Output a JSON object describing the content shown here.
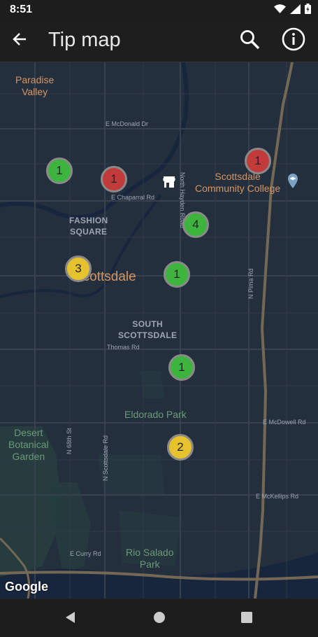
{
  "status_bar": {
    "time": "8:51"
  },
  "app_bar": {
    "title": "Tip map"
  },
  "map": {
    "area_labels": [
      {
        "text": "Paradise\nValley"
      },
      {
        "text": "Scottsdale\nCommunity College"
      },
      {
        "text": "Desert\nBotanical\nGarden"
      },
      {
        "text": "Eldorado Park"
      },
      {
        "text": "Rio Salado\nPark"
      }
    ],
    "city_label": "Scottsdale",
    "district_labels": [
      "FASHION\nSQUARE",
      "SOUTH\nSCOTTSDALE"
    ],
    "road_labels": [
      "E McDonald Dr",
      "E Chaparral Rd",
      "Thomas Rd",
      "E McDowell Rd",
      "E McKellips Rd",
      "E Curry Rd"
    ],
    "vertical_road_labels": [
      "North Hayden Road",
      "N Pima Rd",
      "N 68th St",
      "N Scottsdale Rd"
    ],
    "markers": [
      {
        "count": "1",
        "color": "#3db43d"
      },
      {
        "count": "1",
        "color": "#c23b3b"
      },
      {
        "count": "1",
        "color": "#c23b3b"
      },
      {
        "count": "4",
        "color": "#3db43d"
      },
      {
        "count": "3",
        "color": "#e6c22e"
      },
      {
        "count": "1",
        "color": "#3db43d"
      },
      {
        "count": "1",
        "color": "#3db43d"
      },
      {
        "count": "2",
        "color": "#e6c22e"
      }
    ],
    "attribution": "Google",
    "icons": {
      "store": "store-icon",
      "school_pin": "school-pin-icon"
    }
  },
  "colors": {
    "map_background": "#242f3e",
    "water": "#17263c",
    "park": "#263c3f",
    "road": "#38414e",
    "highway": "#746855"
  }
}
